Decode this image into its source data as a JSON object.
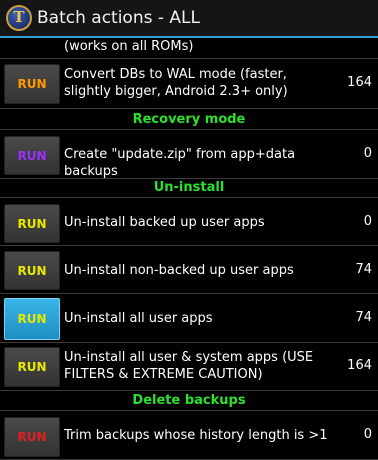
{
  "app": {
    "title": "Batch actions - ALL",
    "icon": "titanium-t-icon",
    "accent": "#2f9fd0"
  },
  "run_label": "RUN",
  "colors": {
    "section": "#2de02d",
    "run_orange": "#ff9a00",
    "run_purple": "#9b30ff",
    "run_yellow": "#e8e800",
    "run_red": "#e02020"
  },
  "partial_row": {
    "label": "(works on all ROMs)"
  },
  "rows": [
    {
      "label": "Convert DBs to WAL mode (faster, slightly bigger, Android 2.3+ only)",
      "count": "164"
    },
    {
      "label": "Create \"update.zip\" from app+data backups",
      "count": "0"
    },
    {
      "label": "Un-install backed up user apps",
      "count": "0"
    },
    {
      "label": "Un-install non-backed up user apps",
      "count": "74"
    },
    {
      "label": "Un-install all user apps",
      "count": "74"
    },
    {
      "label": "Un-install all user & system apps (USE FILTERS & EXTREME CAUTION)",
      "count": "164"
    },
    {
      "label": "Trim backups whose history length is >1",
      "count": "0"
    }
  ],
  "sections": [
    "Recovery mode",
    "Un-install",
    "Delete backups"
  ]
}
